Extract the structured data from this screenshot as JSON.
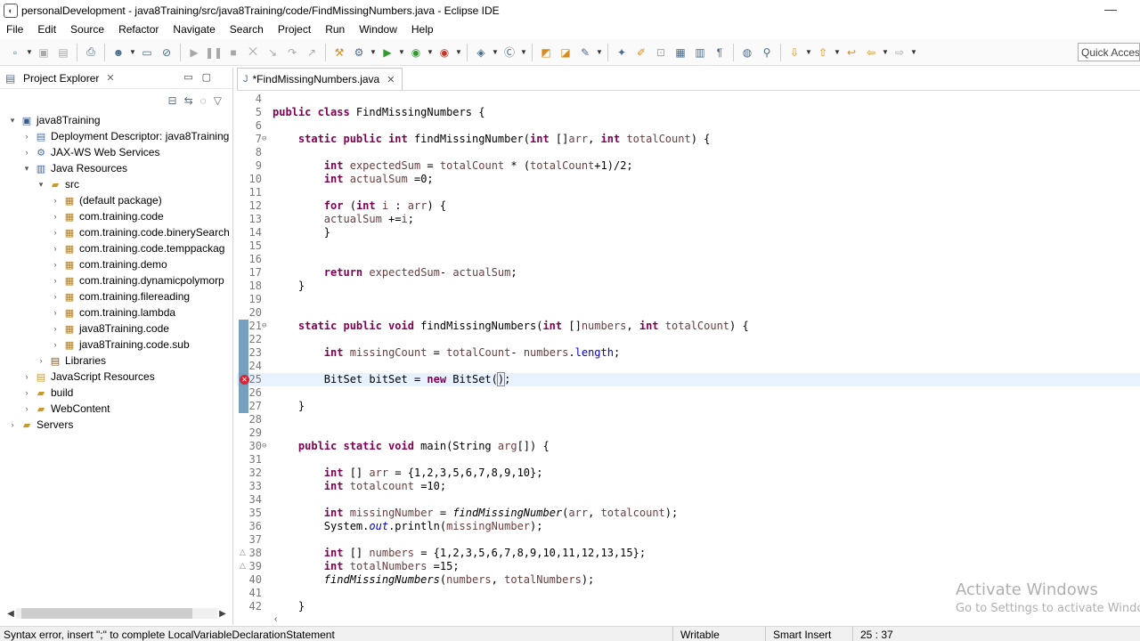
{
  "window": {
    "title": "personalDevelopment - java8Training/src/java8Training/code/FindMissingNumbers.java - Eclipse IDE",
    "minimize_glyph": "—"
  },
  "menu": [
    "File",
    "Edit",
    "Source",
    "Refactor",
    "Navigate",
    "Search",
    "Project",
    "Run",
    "Window",
    "Help"
  ],
  "toolbar": {
    "quick_access": "Quick Access"
  },
  "explorer": {
    "title": "Project Explorer",
    "items": [
      {
        "label": "java8Training",
        "level": 0,
        "expanded": true,
        "icon": "project-icon"
      },
      {
        "label": "Deployment Descriptor: java8Training",
        "level": 1,
        "expanded": false,
        "icon": "descriptor-icon"
      },
      {
        "label": "JAX-WS Web Services",
        "level": 1,
        "expanded": false,
        "icon": "webservice-icon"
      },
      {
        "label": "Java Resources",
        "level": 1,
        "expanded": true,
        "icon": "java-resources-icon"
      },
      {
        "label": "src",
        "level": 2,
        "expanded": true,
        "icon": "source-folder-icon"
      },
      {
        "label": "(default package)",
        "level": 3,
        "expanded": false,
        "icon": "package-icon"
      },
      {
        "label": "com.training.code",
        "level": 3,
        "expanded": false,
        "icon": "package-icon"
      },
      {
        "label": "com.training.code.binerySearch",
        "level": 3,
        "expanded": false,
        "icon": "package-icon"
      },
      {
        "label": "com.training.code.temppackag",
        "level": 3,
        "expanded": false,
        "icon": "package-icon"
      },
      {
        "label": "com.training.demo",
        "level": 3,
        "expanded": false,
        "icon": "package-icon"
      },
      {
        "label": "com.training.dynamicpolymorp",
        "level": 3,
        "expanded": false,
        "icon": "package-icon"
      },
      {
        "label": "com.training.filereading",
        "level": 3,
        "expanded": false,
        "icon": "package-icon"
      },
      {
        "label": "com.training.lambda",
        "level": 3,
        "expanded": false,
        "icon": "package-icon"
      },
      {
        "label": "java8Training.code",
        "level": 3,
        "expanded": false,
        "icon": "package-icon"
      },
      {
        "label": "java8Training.code.sub",
        "level": 3,
        "expanded": false,
        "icon": "package-icon"
      },
      {
        "label": "Libraries",
        "level": 2,
        "expanded": false,
        "icon": "library-icon"
      },
      {
        "label": "JavaScript Resources",
        "level": 1,
        "expanded": false,
        "icon": "js-resources-icon"
      },
      {
        "label": "build",
        "level": 1,
        "expanded": false,
        "icon": "folder-icon"
      },
      {
        "label": "WebContent",
        "level": 1,
        "expanded": false,
        "icon": "folder-icon"
      },
      {
        "label": "Servers",
        "level": 0,
        "expanded": false,
        "icon": "folder-icon"
      }
    ]
  },
  "editor": {
    "tab_label": "*FindMissingNumbers.java",
    "lines": [
      {
        "n": "4",
        "html": ""
      },
      {
        "n": "5",
        "html": "<span class=\"kw\">public class</span> FindMissingNumbers {"
      },
      {
        "n": "6",
        "html": ""
      },
      {
        "n": "7",
        "html": "    <span class=\"kw\">static public int</span> findMissingNumber(<span class=\"kw\">int</span> []<span class=\"var\">arr</span>, <span class=\"kw\">int</span> <span class=\"var\">totalCount</span>) {",
        "fold": true
      },
      {
        "n": "8",
        "html": ""
      },
      {
        "n": "9",
        "html": "        <span class=\"kw\">int</span> <span class=\"var\">expectedSum</span> = <span class=\"var\">totalCount</span> * (<span class=\"var\">totalCount</span>+1)/2;"
      },
      {
        "n": "10",
        "html": "        <span class=\"kw\">int</span> <span class=\"var\">actualSum</span> =0;"
      },
      {
        "n": "11",
        "html": ""
      },
      {
        "n": "12",
        "html": "        <span class=\"kw\">for</span> (<span class=\"kw\">int</span> <span class=\"var\">i</span> : <span class=\"var\">arr</span>) {"
      },
      {
        "n": "13",
        "html": "        <span class=\"var\">actualSum</span> +=<span class=\"var\">i</span>;"
      },
      {
        "n": "14",
        "html": "        }"
      },
      {
        "n": "15",
        "html": ""
      },
      {
        "n": "16",
        "html": ""
      },
      {
        "n": "17",
        "html": "        <span class=\"kw\">return</span> <span class=\"var\">expectedSum</span>- <span class=\"var\">actualSum</span>;"
      },
      {
        "n": "18",
        "html": "    }"
      },
      {
        "n": "19",
        "html": ""
      },
      {
        "n": "20",
        "html": ""
      },
      {
        "n": "21",
        "html": "    <span class=\"kw\">static public void</span> findMissingNumbers(<span class=\"kw\">int</span> []<span class=\"var\">numbers</span>, <span class=\"kw\">int</span> <span class=\"var\">totalCount</span>) {",
        "fold": true,
        "mark": true
      },
      {
        "n": "22",
        "html": "",
        "mark": true
      },
      {
        "n": "23",
        "html": "        <span class=\"kw\">int</span> <span class=\"var\">missingCount</span> = <span class=\"var\">totalCount</span>- <span class=\"var\">numbers</span>.<span class=\"fld\">length</span>;",
        "mark": true
      },
      {
        "n": "24",
        "html": "",
        "mark": true
      },
      {
        "n": "25",
        "html": "        BitSet bitSet = <span class=\"kw\">new</span> BitSet(<span class=\"caret-box\">)</span>;",
        "mark": true,
        "error": true,
        "current": true
      },
      {
        "n": "26",
        "html": "",
        "mark": true
      },
      {
        "n": "27",
        "html": "    }",
        "mark": true
      },
      {
        "n": "28",
        "html": ""
      },
      {
        "n": "29",
        "html": ""
      },
      {
        "n": "30",
        "html": "    <span class=\"kw\">public static void</span> main(String <span class=\"var\">arg</span>[]) {",
        "fold": true
      },
      {
        "n": "31",
        "html": ""
      },
      {
        "n": "32",
        "html": "        <span class=\"kw\">int</span> [] <span class=\"var\">arr</span> = {1,2,3,5,6,7,8,9,10};"
      },
      {
        "n": "33",
        "html": "        <span class=\"kw\">int</span> <span class=\"var\">totalcount</span> =10;"
      },
      {
        "n": "34",
        "html": ""
      },
      {
        "n": "35",
        "html": "        <span class=\"kw\">int</span> <span class=\"var\">missingNumber</span> = <span class=\"it\">findMissingNumber</span>(<span class=\"var\">arr</span>, <span class=\"var\">totalcount</span>);"
      },
      {
        "n": "36",
        "html": "        System.<span class=\"fld it\">out</span>.println(<span class=\"var\">missingNumber</span>);"
      },
      {
        "n": "37",
        "html": ""
      },
      {
        "n": "38",
        "html": "        <span class=\"kw\">int</span> [] <span class=\"var\">numbers</span> = {1,2,3,5,6,7,8,9,10,11,12,13,15};",
        "warn": true
      },
      {
        "n": "39",
        "html": "        <span class=\"kw\">int</span> <span class=\"var\">totalNumbers</span> =15;",
        "warn": true
      },
      {
        "n": "40",
        "html": "        <span class=\"it\">findMissingNumbers</span>(<span class=\"var\">numbers</span>, <span class=\"var\">totalNumbers</span>);"
      },
      {
        "n": "41",
        "html": ""
      },
      {
        "n": "42",
        "html": "    }"
      }
    ]
  },
  "watermark": {
    "line1": "Activate Windows",
    "line2": "Go to Settings to activate Windows."
  },
  "status": {
    "message": "Syntax error, insert \";\" to complete LocalVariableDeclarationStatement",
    "mode": "Writable",
    "insert": "Smart Insert",
    "position": "25 : 37"
  },
  "colors": {
    "keyword": "#7f0055",
    "local_variable": "#6a3e3e",
    "field": "#0000c0",
    "current_line": "#e8f2fe",
    "error": "#dd2233"
  }
}
